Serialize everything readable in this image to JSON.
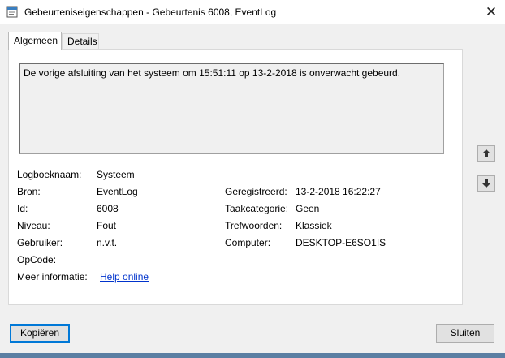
{
  "window": {
    "title": "Gebeurteniseigenschappen - Gebeurtenis 6008, EventLog",
    "close_glyph": "✕"
  },
  "tabs": [
    {
      "label": "Algemeen",
      "active": true
    },
    {
      "label": "Details",
      "active": false
    }
  ],
  "description": "De vorige afsluiting van het systeem om 15:51:11 op 13-2-2018 is onverwacht gebeurd.",
  "fields": {
    "logboeknaam": {
      "label": "Logboeknaam:",
      "value": "Systeem"
    },
    "bron": {
      "label": "Bron:",
      "value": "EventLog"
    },
    "id": {
      "label": "Id:",
      "value": "6008"
    },
    "niveau": {
      "label": "Niveau:",
      "value": "Fout"
    },
    "gebruiker": {
      "label": "Gebruiker:",
      "value": "n.v.t."
    },
    "opcode": {
      "label": "OpCode:",
      "value": ""
    },
    "meer_informatie": {
      "label": "Meer informatie:",
      "link": "Help online"
    },
    "geregistreerd": {
      "label": "Geregistreerd:",
      "value": "13-2-2018 16:22:27"
    },
    "taakcategorie": {
      "label": "Taakcategorie:",
      "value": "Geen"
    },
    "trefwoorden": {
      "label": "Trefwoorden:",
      "value": "Klassiek"
    },
    "computer": {
      "label": "Computer:",
      "value": "DESKTOP-E6SO1IS"
    }
  },
  "buttons": {
    "copy": "Kopiëren",
    "close": "Sluiten"
  },
  "icons": {
    "up": "arrow-up-icon",
    "down": "arrow-down-icon",
    "app": "event-properties-icon"
  },
  "colors": {
    "link": "#0033cc",
    "focus_border": "#0078d7",
    "taskbar": "#5c7fa3"
  }
}
